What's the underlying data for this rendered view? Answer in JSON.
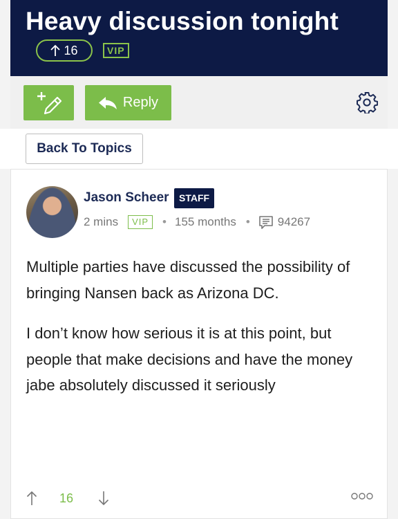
{
  "header": {
    "title": "Heavy discussion tonight",
    "votes": "16",
    "vip_label": "VIP"
  },
  "toolbar": {
    "reply_label": "Reply"
  },
  "nav": {
    "back_label": "Back To Topics"
  },
  "post": {
    "author": "Jason Scheer",
    "staff_label": "STAFF",
    "time": "2 mins",
    "vip_label": "VIP",
    "tenure": "155 months",
    "post_count": "94267",
    "paragraphs": [
      "Multiple parties have discussed the possibility of bringing Nansen back as Arizona DC.",
      "I don’t know how serious it is at this point, but people that make decisions and have the money jabe absolutely discussed it seriously"
    ],
    "votes": "16"
  },
  "colors": {
    "navy": "#0d1a45",
    "green": "#7cbd4a"
  }
}
